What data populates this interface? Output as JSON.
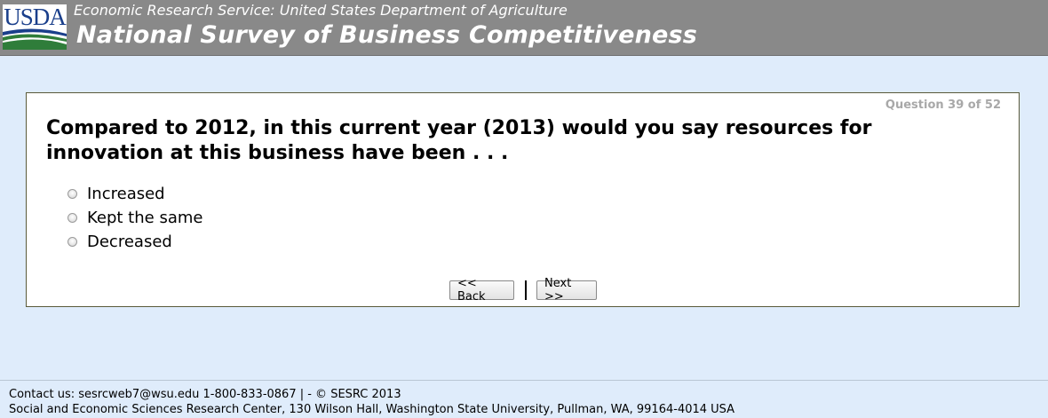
{
  "header": {
    "logo_text": "USDA",
    "agency": "Economic Research Service: United States Department of Agriculture",
    "title": "National Survey of Business Competitiveness"
  },
  "question": {
    "progress": "Question 39 of 52",
    "text": "Compared to 2012, in this current year (2013) would you say resources for innovation at this business have been . . .",
    "options": [
      {
        "label": "Increased",
        "selected": false
      },
      {
        "label": "Kept the same",
        "selected": false
      },
      {
        "label": "Decreased",
        "selected": false
      }
    ]
  },
  "nav": {
    "back_label": "<< Back",
    "next_label": "Next >>"
  },
  "footer": {
    "contact": "Contact us: sesrcweb7@wsu.edu 1-800-833-0867 | - © SESRC 2013",
    "address": "Social and Economic Sciences Research Center, 130 Wilson Hall, Washington State University, Pullman, WA, 99164-4014 USA"
  },
  "colors": {
    "page_background": "#dfecfb",
    "header_background": "#898989",
    "logo_blue": "#1a3f8b",
    "logo_green": "#2f7d3a"
  }
}
